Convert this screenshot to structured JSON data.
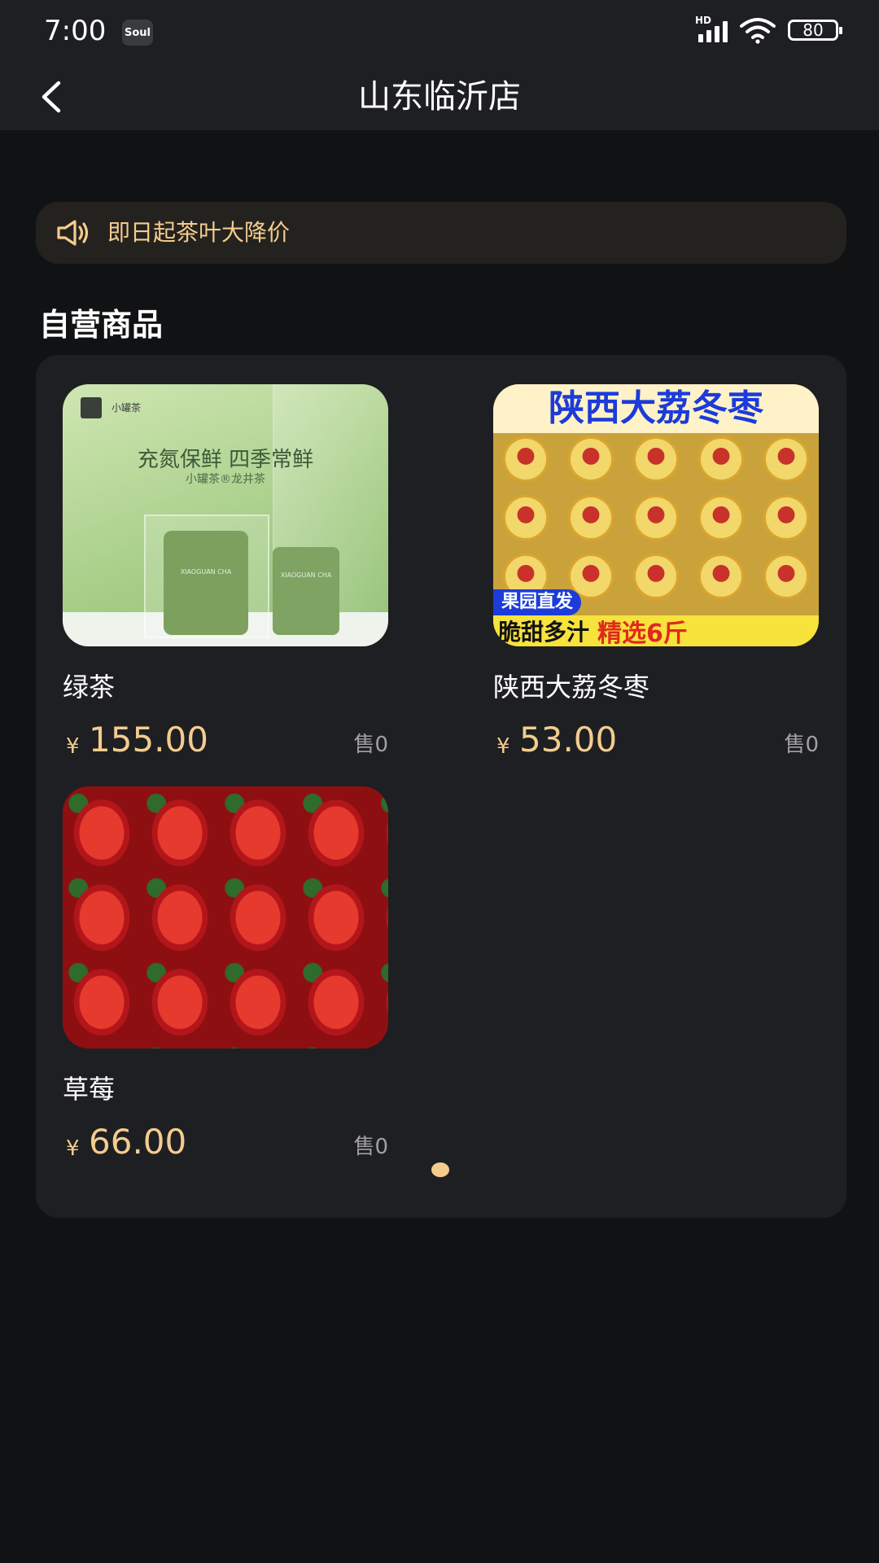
{
  "status_bar": {
    "time": "7:00",
    "app_icon_label": "Soul",
    "network_label": "HD",
    "battery": "80",
    "icons": [
      "soul-app-icon",
      "signal-icon",
      "wifi-icon",
      "battery-icon"
    ]
  },
  "nav": {
    "title": "山东临沂店",
    "back_icon": "chevron-left-icon"
  },
  "notice": {
    "icon": "speaker-icon",
    "text": "即日起茶叶大降价"
  },
  "section": {
    "title": "自营商品"
  },
  "products": [
    {
      "name": "绿茶",
      "currency": "¥",
      "price": "155.00",
      "sold": "售0",
      "image": {
        "brand": "小罐茶",
        "headline": "充氮保鲜 四季常鲜",
        "subline": "小罐茶®龙井茶",
        "can_label": "XIAOGUAN CHA"
      }
    },
    {
      "name": "陕西大荔冬枣",
      "currency": "¥",
      "price": "53.00",
      "sold": "售0",
      "image": {
        "headline": "陕西大荔冬枣",
        "badge": "果园直发",
        "tagline_left": "脆甜多汁",
        "tagline_right": "精选6斤"
      }
    },
    {
      "name": "草莓",
      "currency": "¥",
      "price": "66.00",
      "sold": "售0",
      "image": {}
    }
  ],
  "colors": {
    "accent": "#f3cc8e",
    "background": "#111214",
    "panel": "#1e1f22"
  }
}
